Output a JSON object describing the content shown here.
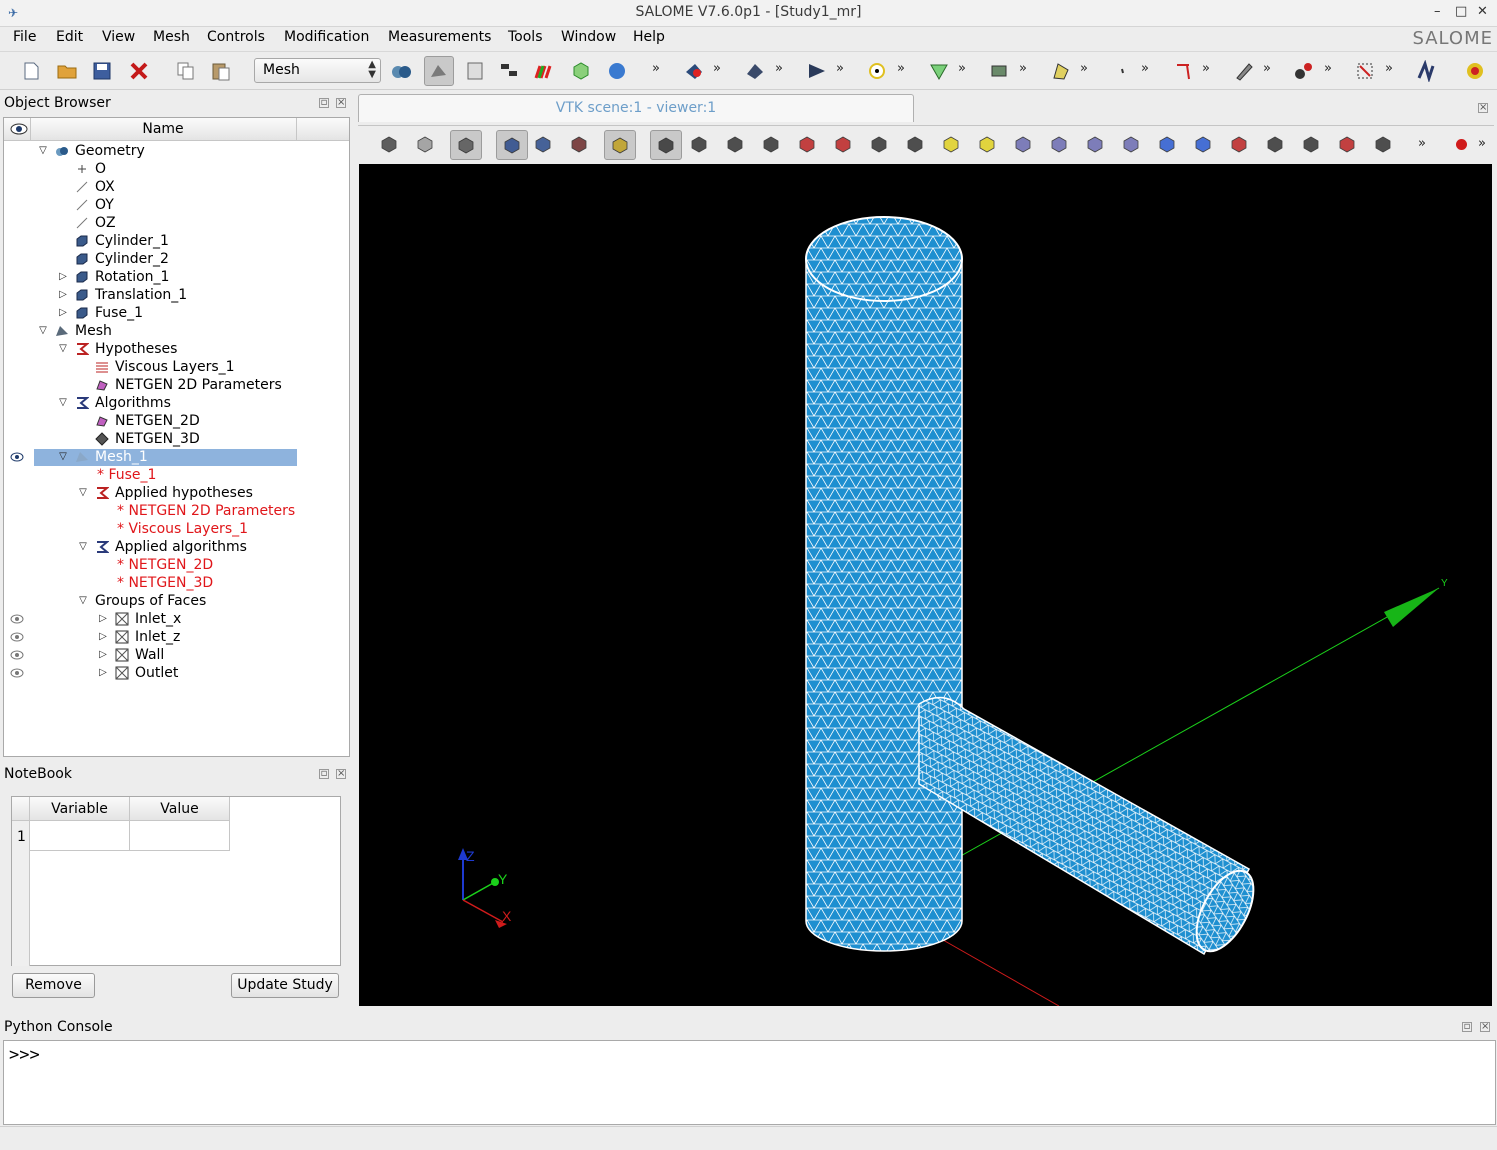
{
  "window": {
    "title": "SALOME  V7.6.0p1 - [Study1_mr]",
    "controls": [
      "–",
      "□",
      "✕"
    ]
  },
  "menubar": {
    "items": [
      "File",
      "Edit",
      "View",
      "Mesh",
      "Controls",
      "Modification",
      "Measurements",
      "Tools",
      "Window",
      "Help"
    ],
    "brand": "SALOME"
  },
  "toolbar": {
    "module": "Mesh",
    "more": "»"
  },
  "object_browser": {
    "title": "Object Browser",
    "column_name": "Name",
    "items": [
      "Geometry",
      "O",
      "OX",
      "OY",
      "OZ",
      "Cylinder_1",
      "Cylinder_2",
      "Rotation_1",
      "Translation_1",
      "Fuse_1",
      "Mesh",
      "Hypotheses",
      "Viscous Layers_1",
      "NETGEN 2D Parameters",
      "Algorithms",
      "NETGEN_2D",
      "NETGEN_3D",
      "Mesh_1",
      "* Fuse_1",
      "Applied hypotheses",
      "* NETGEN 2D Parameters",
      "* Viscous Layers_1",
      "Applied algorithms",
      "* NETGEN_2D",
      "* NETGEN_3D",
      "Groups of Faces",
      "Inlet_x",
      "Inlet_z",
      "Wall",
      "Outlet"
    ]
  },
  "notebook": {
    "title": "NoteBook",
    "col_variable": "Variable",
    "col_value": "Value",
    "row1": "1",
    "remove": "Remove",
    "update": "Update Study"
  },
  "viewer": {
    "tab": "VTK scene:1 - viewer:1",
    "axis_x": "X",
    "axis_y": "Y",
    "axis_z": "Z"
  },
  "console": {
    "title": "Python Console",
    "prompt": ">>>"
  },
  "colors": {
    "mesh_fill": "#1e8fd0",
    "mesh_edge": "#ffffff",
    "selection": "#8eb3dd",
    "ref_red": "#e0161a",
    "tab_text": "#6d9ec9"
  }
}
